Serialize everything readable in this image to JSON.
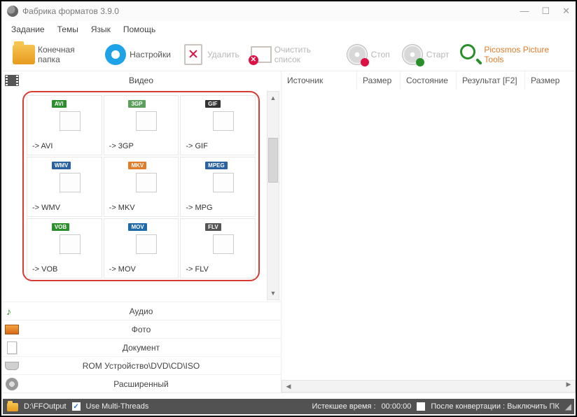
{
  "window": {
    "title": "Фабрика форматов 3.9.0"
  },
  "menu": {
    "task": "Задание",
    "skins": "Темы",
    "lang": "Язык",
    "help": "Помощь"
  },
  "toolbar": {
    "output_folder": "Конечная папка",
    "settings": "Настройки",
    "delete": "Удалить",
    "clear_list": "Очистить список",
    "stop": "Стоп",
    "start": "Старт",
    "picosmos": "Picosmos Picture Tools"
  },
  "categories": {
    "video": "Видео",
    "audio": "Аудио",
    "photo": "Фото",
    "document": "Документ",
    "rom": "ROM Устройство\\DVD\\CD\\ISO",
    "advanced": "Расширенный"
  },
  "formats": [
    {
      "label": "-> AVI",
      "badge": "AVI",
      "badge_color": "#2a8f2a"
    },
    {
      "label": "-> 3GP",
      "badge": "3GP",
      "badge_color": "#5aa05a"
    },
    {
      "label": "-> GIF",
      "badge": "GIF",
      "badge_color": "#333333"
    },
    {
      "label": "-> WMV",
      "badge": "WMV",
      "badge_color": "#2a62a0"
    },
    {
      "label": "-> MKV",
      "badge": "MKV",
      "badge_color": "#e07c2a"
    },
    {
      "label": "-> MPG",
      "badge": "MPEG",
      "badge_color": "#2a62a0"
    },
    {
      "label": "-> VOB",
      "badge": "VOB",
      "badge_color": "#2a8f2a"
    },
    {
      "label": "-> MOV",
      "badge": "MOV",
      "badge_color": "#1f6aa8"
    },
    {
      "label": "-> FLV",
      "badge": "FLV",
      "badge_color": "#555555"
    }
  ],
  "columns": {
    "source": "Источник",
    "size": "Размер",
    "state": "Состояние",
    "result": "Результат [F2]",
    "size2": "Размер"
  },
  "status": {
    "out_path": "D:\\FFOutput",
    "multi_threads": "Use Multi-Threads",
    "elapsed_label": "Истекшее время :",
    "elapsed_value": "00:00:00",
    "shutdown": "После конвертации : Выключить ПК"
  }
}
